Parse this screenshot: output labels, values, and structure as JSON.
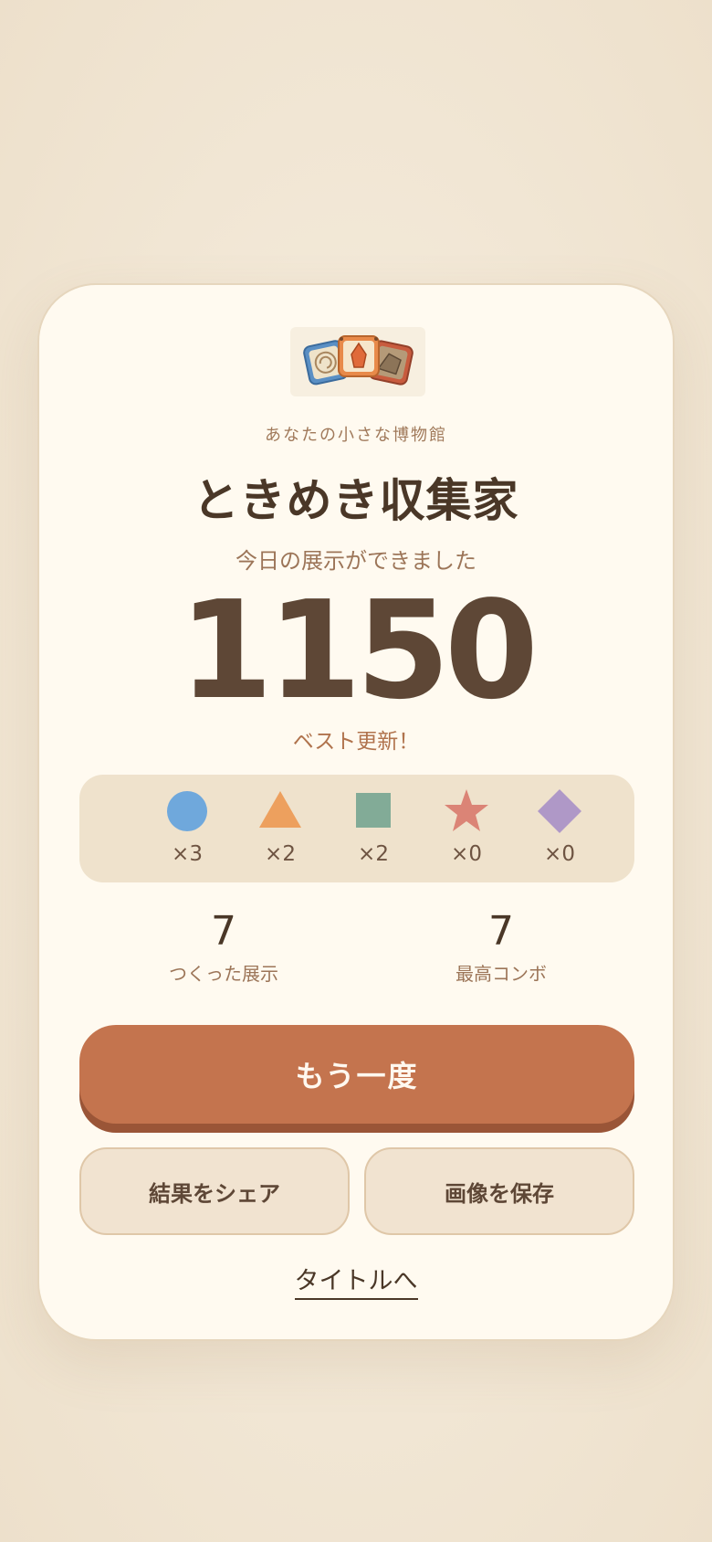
{
  "result": {
    "eyebrow": "あなたの小さな博物館",
    "title": "ときめき収集家",
    "subtitle": "今日の展示ができました",
    "score": "1150",
    "best_label": "ベスト更新！"
  },
  "shapes": [
    {
      "icon": "circle-icon",
      "color": "#6fa8dc",
      "count": "×3"
    },
    {
      "icon": "triangle-icon",
      "color": "#eda05e",
      "count": "×2"
    },
    {
      "icon": "square-icon",
      "color": "#82ab97",
      "count": "×2"
    },
    {
      "icon": "star-icon",
      "color": "#db8476",
      "count": "×0"
    },
    {
      "icon": "diamond-icon",
      "color": "#af98c7",
      "count": "×0"
    }
  ],
  "stats": {
    "exhibits_value": "7",
    "exhibits_label": "つくった展示",
    "combo_value": "7",
    "combo_label": "最高コンボ"
  },
  "buttons": {
    "retry": "もう一度",
    "share": "結果をシェア",
    "save": "画像を保存",
    "title": "タイトルへ"
  },
  "colors": {
    "accent": "#c4744e",
    "card": "#fffaf0",
    "panel": "#efe2cc"
  }
}
